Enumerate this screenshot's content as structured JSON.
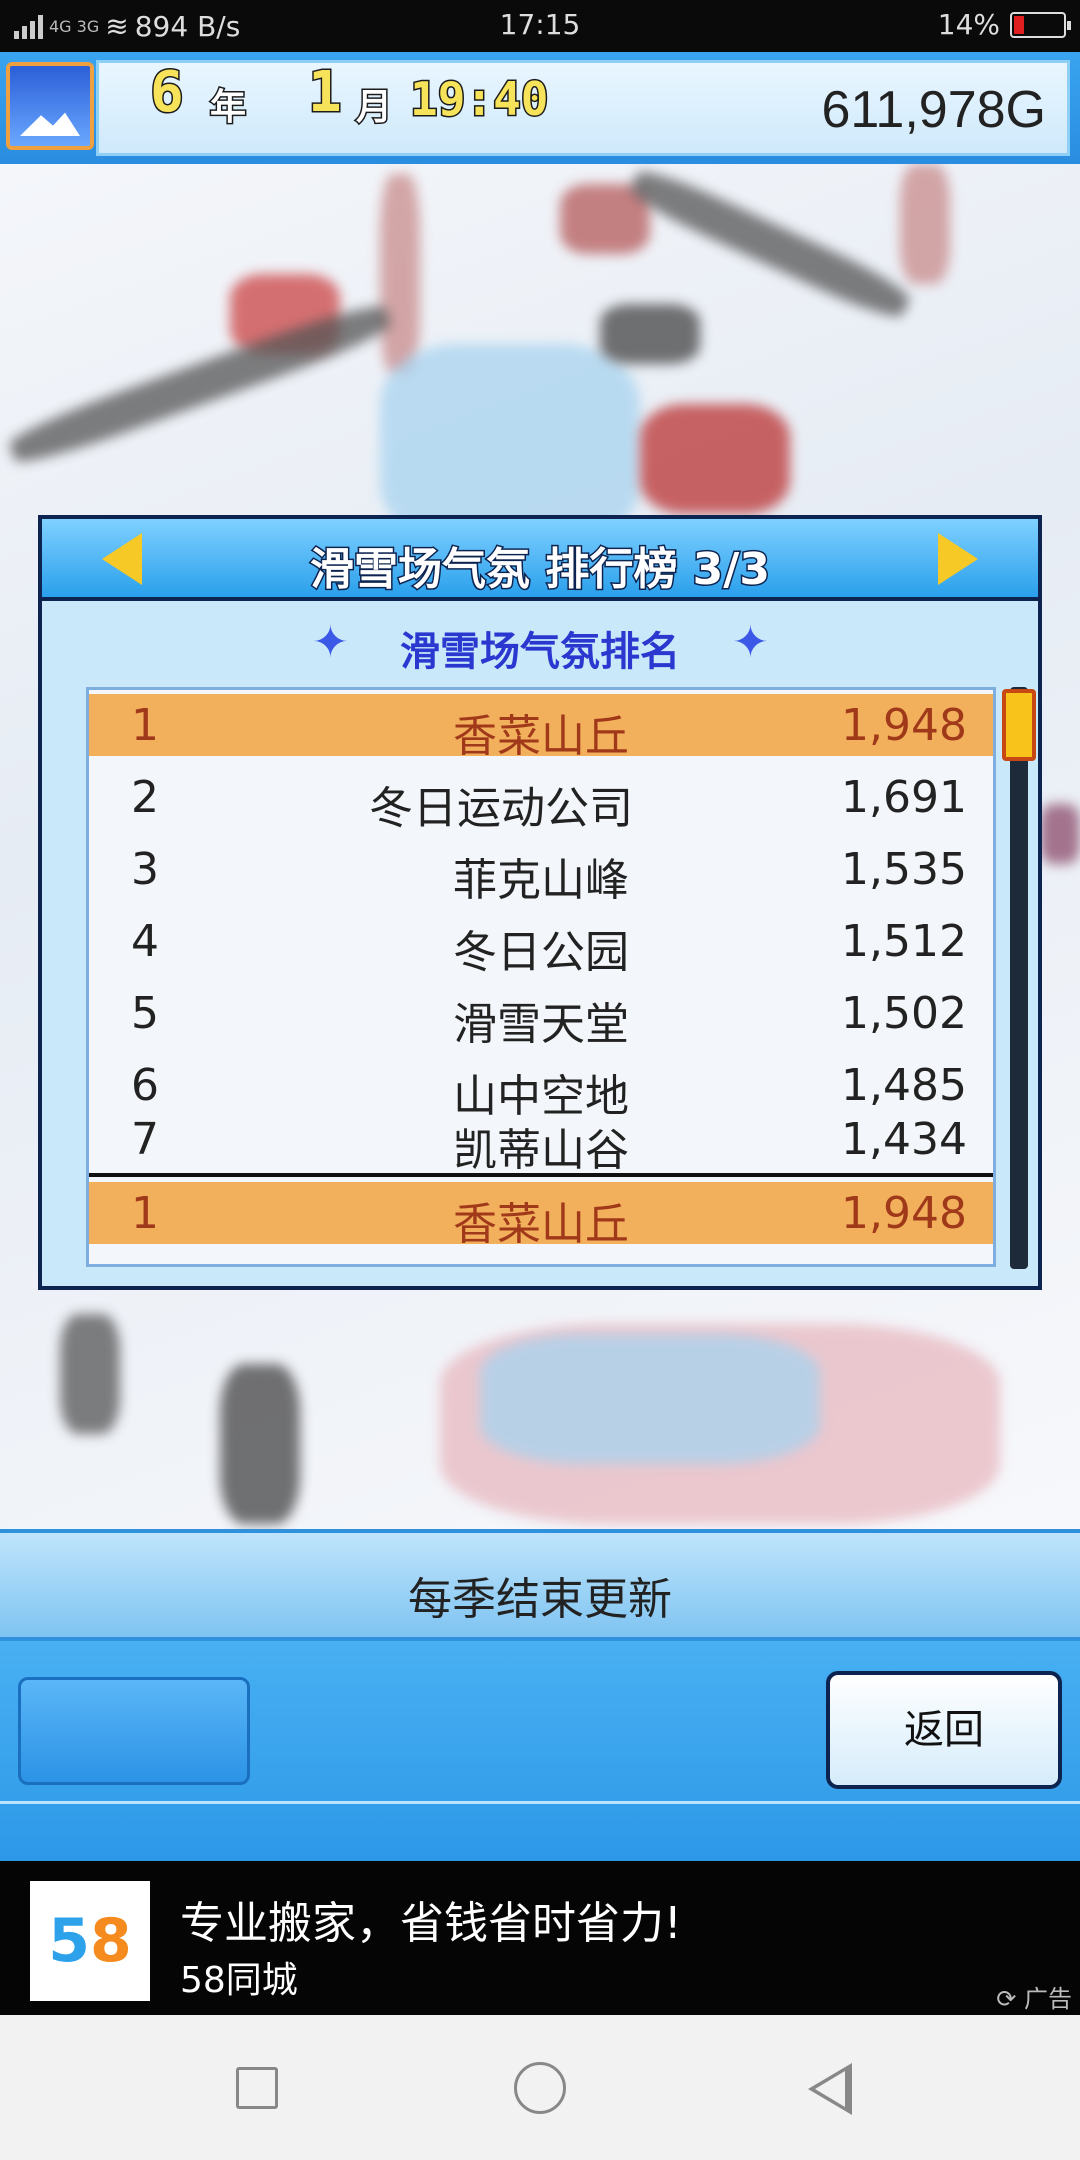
{
  "status_bar": {
    "network": "4G 3G",
    "speed": "894 B/s",
    "time": "17:15",
    "battery": "14%",
    "battery_color": "#e02020"
  },
  "game_header": {
    "year_number": "6",
    "year_unit": "年",
    "month_number": "1",
    "month_unit": "月",
    "clock": "19:40",
    "money": "611,978G"
  },
  "ranking_panel": {
    "title": "滑雪场气氛 排行榜 3/3",
    "subtitle": "滑雪场气氛排名",
    "rows": [
      {
        "rank": "1",
        "name": "香菜山丘",
        "score": "1,948",
        "highlight": true
      },
      {
        "rank": "2",
        "name": "冬日运动公司",
        "score": "1,691",
        "highlight": false
      },
      {
        "rank": "3",
        "name": "菲克山峰",
        "score": "1,535",
        "highlight": false
      },
      {
        "rank": "4",
        "name": "冬日公园",
        "score": "1,512",
        "highlight": false
      },
      {
        "rank": "5",
        "name": "滑雪天堂",
        "score": "1,502",
        "highlight": false
      },
      {
        "rank": "6",
        "name": "山中空地",
        "score": "1,485",
        "highlight": false
      },
      {
        "rank": "7",
        "name": "凯蒂山谷",
        "score": "1,434",
        "highlight": false
      }
    ],
    "own_row": {
      "rank": "1",
      "name": "香菜山丘",
      "score": "1,948"
    },
    "highlight_color": "#f3b05c"
  },
  "footer": {
    "update_note": "每季结束更新",
    "back_button": "返回"
  },
  "ad": {
    "logo_left": "5",
    "logo_right": "8",
    "title": "专业搬家，省钱省时省力!",
    "brand": "58同城",
    "tag": "广告"
  }
}
